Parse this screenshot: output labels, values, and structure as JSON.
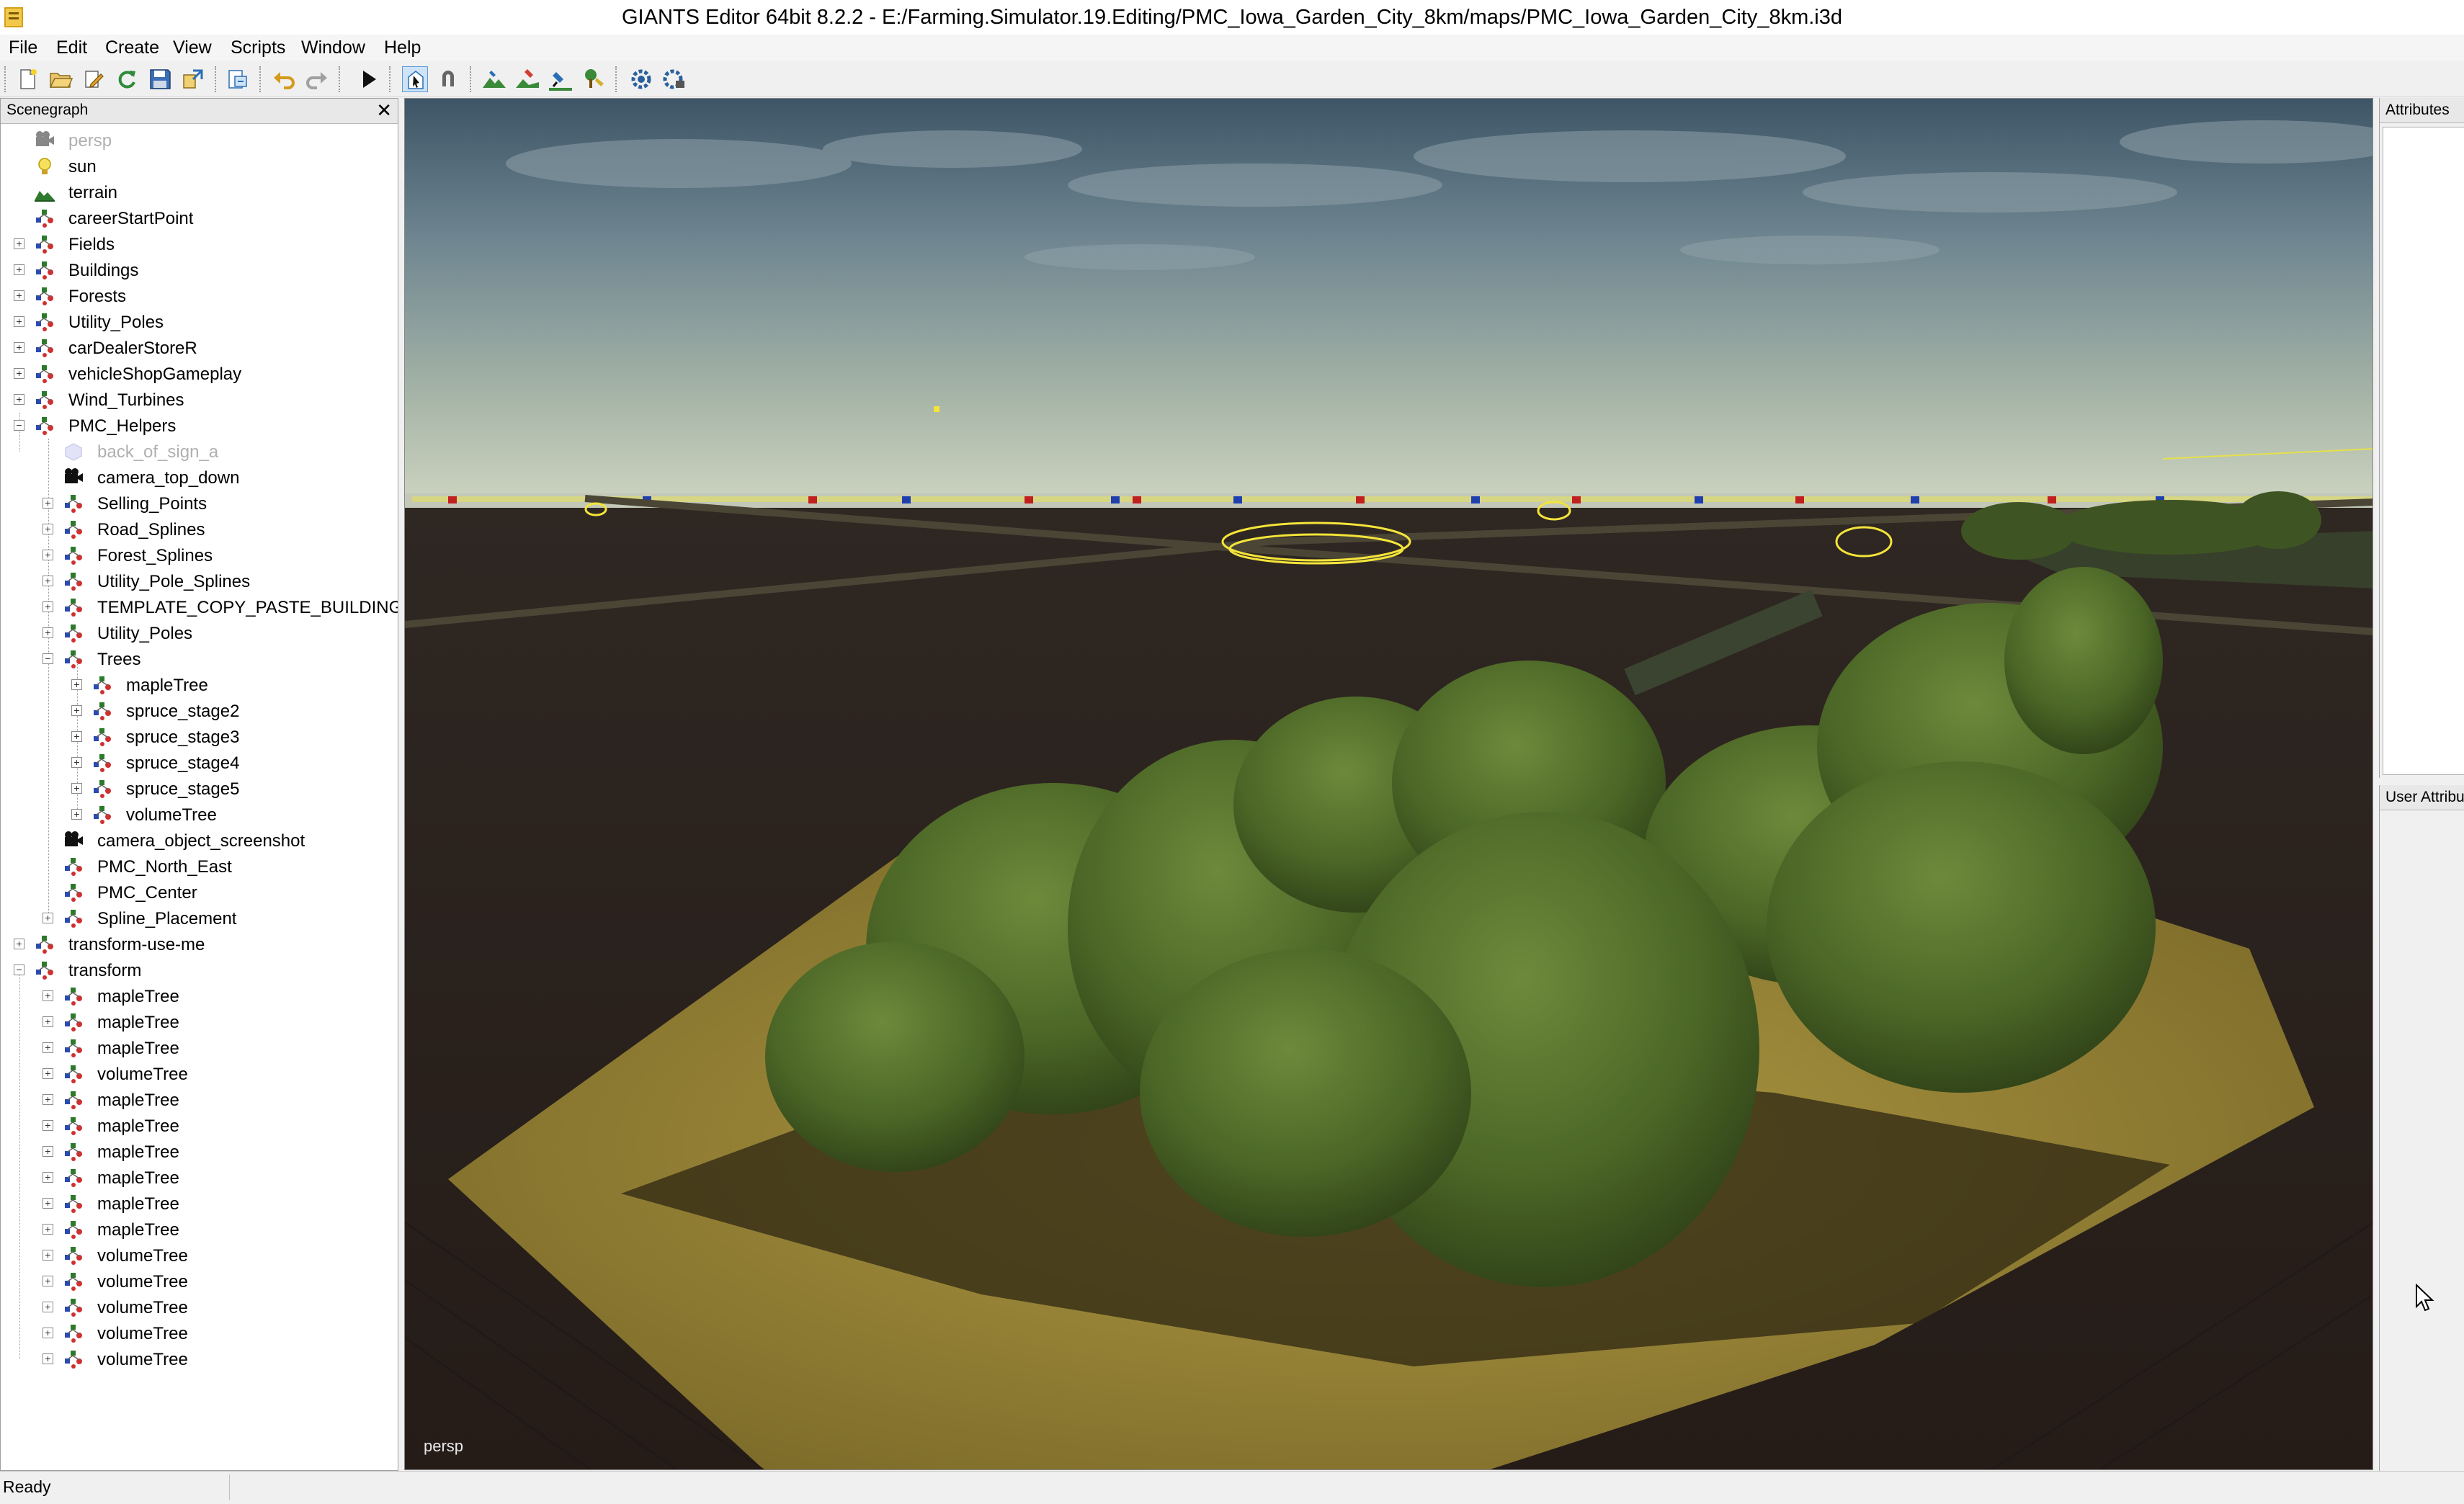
{
  "window": {
    "title": "GIANTS Editor 64bit 8.2.2 - E:/Farming.Simulator.19.Editing/PMC_Iowa_Garden_City_8km/maps/PMC_Iowa_Garden_City_8km.i3d"
  },
  "menu": [
    "File",
    "Edit",
    "Create",
    "View",
    "Scripts",
    "Window",
    "Help"
  ],
  "toolbar": {
    "buttons": [
      "new-icon",
      "open-icon",
      "edit-icon",
      "refresh-icon",
      "save-icon",
      "export-icon",
      "import-icon",
      "undo-icon",
      "redo-icon",
      "play-icon",
      "select-icon",
      "magnet-icon",
      "terrain-sculpt-icon",
      "terrain-paint-icon",
      "foliage-paint-icon",
      "tree-paint-icon",
      "settings-icon",
      "camera-icon"
    ]
  },
  "scenegraph": {
    "title": "Scenegraph",
    "close": "✕",
    "nodes": [
      {
        "label": "persp",
        "icon": "camera",
        "depth": 0,
        "expander": "none",
        "dim": true
      },
      {
        "label": "sun",
        "icon": "light",
        "depth": 0,
        "expander": "none"
      },
      {
        "label": "terrain",
        "icon": "terrain",
        "depth": 0,
        "expander": "none"
      },
      {
        "label": "careerStartPoint",
        "icon": "transform",
        "depth": 0,
        "expander": "none"
      },
      {
        "label": "Fields",
        "icon": "transform",
        "depth": 0,
        "expander": "plus"
      },
      {
        "label": "Buildings",
        "icon": "transform",
        "depth": 0,
        "expander": "plus"
      },
      {
        "label": "Forests",
        "icon": "transform",
        "depth": 0,
        "expander": "plus"
      },
      {
        "label": "Utility_Poles",
        "icon": "transform",
        "depth": 0,
        "expander": "plus"
      },
      {
        "label": "carDealerStoreR",
        "icon": "transform",
        "depth": 0,
        "expander": "plus"
      },
      {
        "label": "vehicleShopGameplay",
        "icon": "transform",
        "depth": 0,
        "expander": "plus"
      },
      {
        "label": "Wind_Turbines",
        "icon": "transform",
        "depth": 0,
        "expander": "plus"
      },
      {
        "label": "PMC_Helpers",
        "icon": "transform",
        "depth": 0,
        "expander": "minus"
      },
      {
        "label": "back_of_sign_a",
        "icon": "shape",
        "depth": 1,
        "expander": "none",
        "dim": true
      },
      {
        "label": "camera_top_down",
        "icon": "camera",
        "depth": 1,
        "expander": "none"
      },
      {
        "label": "Selling_Points",
        "icon": "transform",
        "depth": 1,
        "expander": "plus"
      },
      {
        "label": "Road_Splines",
        "icon": "transform",
        "depth": 1,
        "expander": "plus"
      },
      {
        "label": "Forest_Splines",
        "icon": "transform",
        "depth": 1,
        "expander": "plus"
      },
      {
        "label": "Utility_Pole_Splines",
        "icon": "transform",
        "depth": 1,
        "expander": "plus"
      },
      {
        "label": "TEMPLATE_COPY_PASTE_BUILDING",
        "icon": "transform",
        "depth": 1,
        "expander": "plus"
      },
      {
        "label": "Utility_Poles",
        "icon": "transform",
        "depth": 1,
        "expander": "plus"
      },
      {
        "label": "Trees",
        "icon": "transform",
        "depth": 1,
        "expander": "minus"
      },
      {
        "label": "mapleTree",
        "icon": "transform",
        "depth": 2,
        "expander": "plus"
      },
      {
        "label": "spruce_stage2",
        "icon": "transform",
        "depth": 2,
        "expander": "plus"
      },
      {
        "label": "spruce_stage3",
        "icon": "transform",
        "depth": 2,
        "expander": "plus"
      },
      {
        "label": "spruce_stage4",
        "icon": "transform",
        "depth": 2,
        "expander": "plus"
      },
      {
        "label": "spruce_stage5",
        "icon": "transform",
        "depth": 2,
        "expander": "plus"
      },
      {
        "label": "volumeTree",
        "icon": "transform",
        "depth": 2,
        "expander": "plus"
      },
      {
        "label": "camera_object_screenshot",
        "icon": "camera",
        "depth": 1,
        "expander": "none"
      },
      {
        "label": "PMC_North_East",
        "icon": "transform",
        "depth": 1,
        "expander": "none"
      },
      {
        "label": "PMC_Center",
        "icon": "transform",
        "depth": 1,
        "expander": "none"
      },
      {
        "label": "Spline_Placement",
        "icon": "transform",
        "depth": 1,
        "expander": "plus"
      },
      {
        "label": "transform-use-me",
        "icon": "transform",
        "depth": 0,
        "expander": "plus"
      },
      {
        "label": "transform",
        "icon": "transform",
        "depth": 0,
        "expander": "minus"
      },
      {
        "label": "mapleTree",
        "icon": "transform",
        "depth": 1,
        "expander": "plus"
      },
      {
        "label": "mapleTree",
        "icon": "transform",
        "depth": 1,
        "expander": "plus"
      },
      {
        "label": "mapleTree",
        "icon": "transform",
        "depth": 1,
        "expander": "plus"
      },
      {
        "label": "volumeTree",
        "icon": "transform",
        "depth": 1,
        "expander": "plus"
      },
      {
        "label": "mapleTree",
        "icon": "transform",
        "depth": 1,
        "expander": "plus"
      },
      {
        "label": "mapleTree",
        "icon": "transform",
        "depth": 1,
        "expander": "plus"
      },
      {
        "label": "mapleTree",
        "icon": "transform",
        "depth": 1,
        "expander": "plus"
      },
      {
        "label": "mapleTree",
        "icon": "transform",
        "depth": 1,
        "expander": "plus"
      },
      {
        "label": "mapleTree",
        "icon": "transform",
        "depth": 1,
        "expander": "plus"
      },
      {
        "label": "mapleTree",
        "icon": "transform",
        "depth": 1,
        "expander": "plus"
      },
      {
        "label": "volumeTree",
        "icon": "transform",
        "depth": 1,
        "expander": "plus"
      },
      {
        "label": "volumeTree",
        "icon": "transform",
        "depth": 1,
        "expander": "plus"
      },
      {
        "label": "volumeTree",
        "icon": "transform",
        "depth": 1,
        "expander": "plus"
      },
      {
        "label": "volumeTree",
        "icon": "transform",
        "depth": 1,
        "expander": "plus"
      },
      {
        "label": "volumeTree",
        "icon": "transform",
        "depth": 1,
        "expander": "plus"
      }
    ]
  },
  "viewport": {
    "camera_label": "persp"
  },
  "attributes": {
    "title": "Attributes"
  },
  "user_attributes": {
    "title": "User Attributes"
  },
  "status": {
    "text": "Ready"
  },
  "colors": {
    "sky_top": "#3d5566",
    "sky_horizon": "#c9d2bd",
    "ground": "#2b211c",
    "tree_green": "#4f6a2c",
    "crop_yellow": "#9c8a3a",
    "selection_yellow": "#f4e43a"
  }
}
